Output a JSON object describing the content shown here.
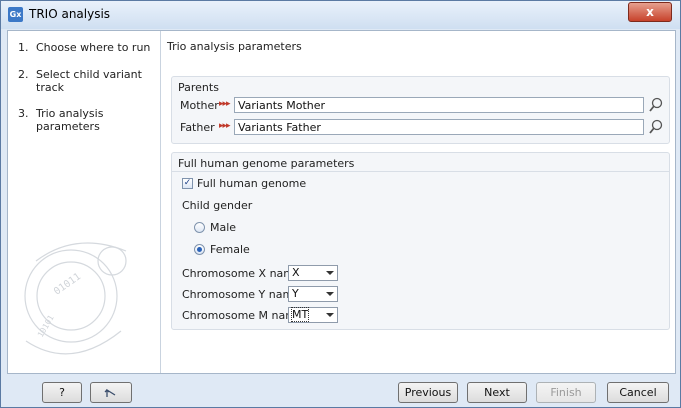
{
  "window": {
    "title": "TRIO analysis",
    "app_icon": "Gx",
    "close_label": "x"
  },
  "steps": [
    {
      "num": "1.",
      "label": "Choose where to run"
    },
    {
      "num": "2.",
      "label": "Select child variant track"
    },
    {
      "num": "3.",
      "label": "Trio analysis parameters"
    }
  ],
  "content": {
    "title": "Trio analysis parameters",
    "parents": {
      "group_title": "Parents",
      "mother": {
        "label": "Mother",
        "value": "Variants Mother"
      },
      "father": {
        "label": "Father",
        "value": "Variants Father"
      }
    },
    "genome": {
      "group_title": "Full human genome parameters",
      "full_genome_label": "Full human genome",
      "full_genome_checked": true,
      "child_gender_label": "Child gender",
      "gender_options": [
        "Male",
        "Female"
      ],
      "selected_gender": "Female",
      "chrom_x": {
        "label": "Chromosome X name",
        "value": "X"
      },
      "chrom_y": {
        "label": "Chromosome Y name",
        "value": "Y"
      },
      "chrom_m": {
        "label": "Chromosome M name",
        "value": "MT"
      }
    }
  },
  "footer": {
    "help_label": "?",
    "reset_icon": "reset-arrow-icon",
    "previous_label": "Previous",
    "next_label": "Next",
    "finish_label": "Finish",
    "cancel_label": "Cancel"
  }
}
